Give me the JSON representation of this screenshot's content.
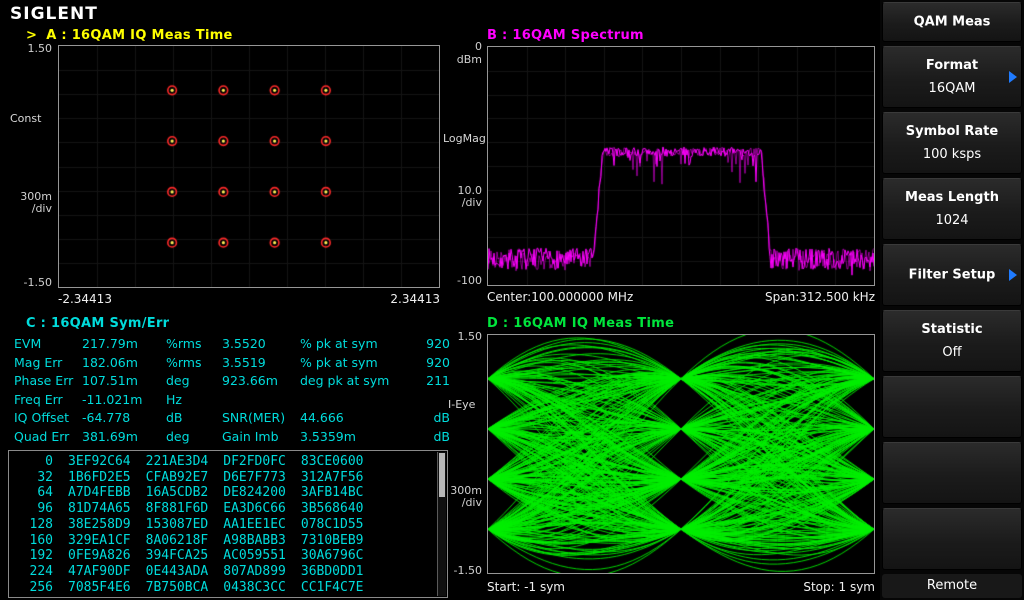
{
  "logo": "SIGLENT",
  "panels": {
    "a": {
      "marker": ">",
      "title": "A :  16QAM  IQ Meas Time",
      "title_color": "#ffff00",
      "y_top": "1.50",
      "y_mid": "Const",
      "y_div_val": "300m",
      "y_div_unit": "/div",
      "y_bottom": "-1.50",
      "x_left": "-2.34413",
      "x_right": "2.34413"
    },
    "b": {
      "title": "B :  16QAM  Spectrum",
      "title_color": "#ff00ff",
      "y_top": "0",
      "y_top_unit": "dBm",
      "y_mid": "LogMag",
      "y_div_val": "10.0",
      "y_div_unit": "/div",
      "y_bottom": "-100",
      "x_left": "Center:100.000000 MHz",
      "x_right": "Span:312.500 kHz"
    },
    "c": {
      "title": "C :  16QAM  Sym/Err",
      "title_color": "#00dcdc",
      "text_color": "#00dcdc"
    },
    "d": {
      "title": "D :  16QAM  IQ Meas Time",
      "title_color": "#00e53c",
      "y_top": "1.50",
      "y_mid": "I-Eye",
      "y_div_val": "300m",
      "y_div_unit": "/div",
      "y_bottom": "-1.50",
      "x_left": "Start: -1 sym",
      "x_right": "Stop: 1 sym"
    }
  },
  "sidebar": {
    "title": "QAM Meas",
    "arrow_color": "#1f7bff",
    "buttons": [
      {
        "label": "Format",
        "value": "16QAM",
        "arrow": true
      },
      {
        "label": "Symbol Rate",
        "value": "100 ksps",
        "arrow": false
      },
      {
        "label": "Meas Length",
        "value": "1024",
        "arrow": false
      },
      {
        "label": "Filter Setup",
        "value": "",
        "arrow": true
      },
      {
        "label": "Statistic",
        "value": "Off",
        "arrow": false
      }
    ],
    "footer": "Remote"
  },
  "chart_data": [
    {
      "id": "constellation",
      "type": "scatter",
      "title": "A : 16QAM IQ Meas Time",
      "xlim": [
        -2.34413,
        2.34413
      ],
      "ylim": [
        -1.5,
        1.5
      ],
      "y_per_div": "300m/div",
      "levels": [
        -0.9487,
        -0.3162,
        0.3162,
        0.9487
      ],
      "points": "16 points at all (I,Q) combinations of levels (4x4 grid)",
      "marker_ring_color": "#ff2a2a",
      "marker_dot_color": "#ffee55"
    },
    {
      "id": "spectrum",
      "type": "line",
      "title": "B : 16QAM Spectrum",
      "scale": "LogMag",
      "ref_level_dbm": 0,
      "db_per_div": 10,
      "ymin_dbm": -100,
      "center": "100.000000 MHz",
      "span": "312.500 kHz",
      "noise_floor_dbm": -89,
      "signal_level_dbm": -44,
      "band_start_frac": 0.285,
      "band_stop_frac": 0.72,
      "color": "#ff00ff"
    },
    {
      "id": "sym-err-table",
      "type": "table",
      "title": "C : 16QAM Sym/Err",
      "meas_rows": [
        [
          "EVM",
          "217.79m",
          "%rms",
          "3.5520",
          "% pk at sym",
          "920"
        ],
        [
          "Mag Err",
          "182.06m",
          "%rms",
          "3.5519",
          "% pk at sym",
          "920"
        ],
        [
          "Phase Err",
          "107.51m",
          "deg",
          "923.66m",
          "deg pk at sym",
          "211"
        ],
        [
          "Freq Err",
          "-11.021m",
          "Hz",
          "",
          "",
          ""
        ],
        [
          "IQ Offset",
          "-64.778",
          "dB",
          "SNR(MER)",
          "44.666",
          "dB"
        ],
        [
          "Quad Err",
          "381.69m",
          "deg",
          "Gain Imb",
          "3.5359m",
          "dB"
        ]
      ],
      "symbol_rows": [
        [
          "0",
          "3EF92C64",
          "221AE3D4",
          "DF2FD0FC",
          "83CE0600"
        ],
        [
          "32",
          "1B6FD2E5",
          "CFAB92E7",
          "D6E7F773",
          "312A7F56"
        ],
        [
          "64",
          "A7D4FEBB",
          "16A5CDB2",
          "DE824200",
          "3AFB14BC"
        ],
        [
          "96",
          "81D74A65",
          "8F881F6D",
          "EA3D6C66",
          "3B568640"
        ],
        [
          "128",
          "38E258D9",
          "153087ED",
          "AA1EE1EC",
          "078C1D55"
        ],
        [
          "160",
          "329EA1CF",
          "8A06218F",
          "A98BABB3",
          "7310BEB9"
        ],
        [
          "192",
          "0FE9A826",
          "394FCA25",
          "AC059551",
          "30A6796C"
        ],
        [
          "224",
          "47AF90DF",
          "0E443ADA",
          "807AD899",
          "36BD0DD1"
        ],
        [
          "256",
          "7085F4E6",
          "7B750BCA",
          "0438C3CC",
          "CC1F4C7E"
        ]
      ]
    },
    {
      "id": "eye-diagram",
      "type": "line",
      "title": "D : 16QAM IQ Meas Time",
      "ylim": [
        -1.5,
        1.5
      ],
      "y_per_div": "300m/div",
      "x_start_sym": -1,
      "x_stop_sym": 1,
      "levels": [
        -0.9487,
        -0.3162,
        0.3162,
        0.9487
      ],
      "rolloff": 0.35,
      "traces": 320,
      "color": "#00ee00"
    }
  ]
}
